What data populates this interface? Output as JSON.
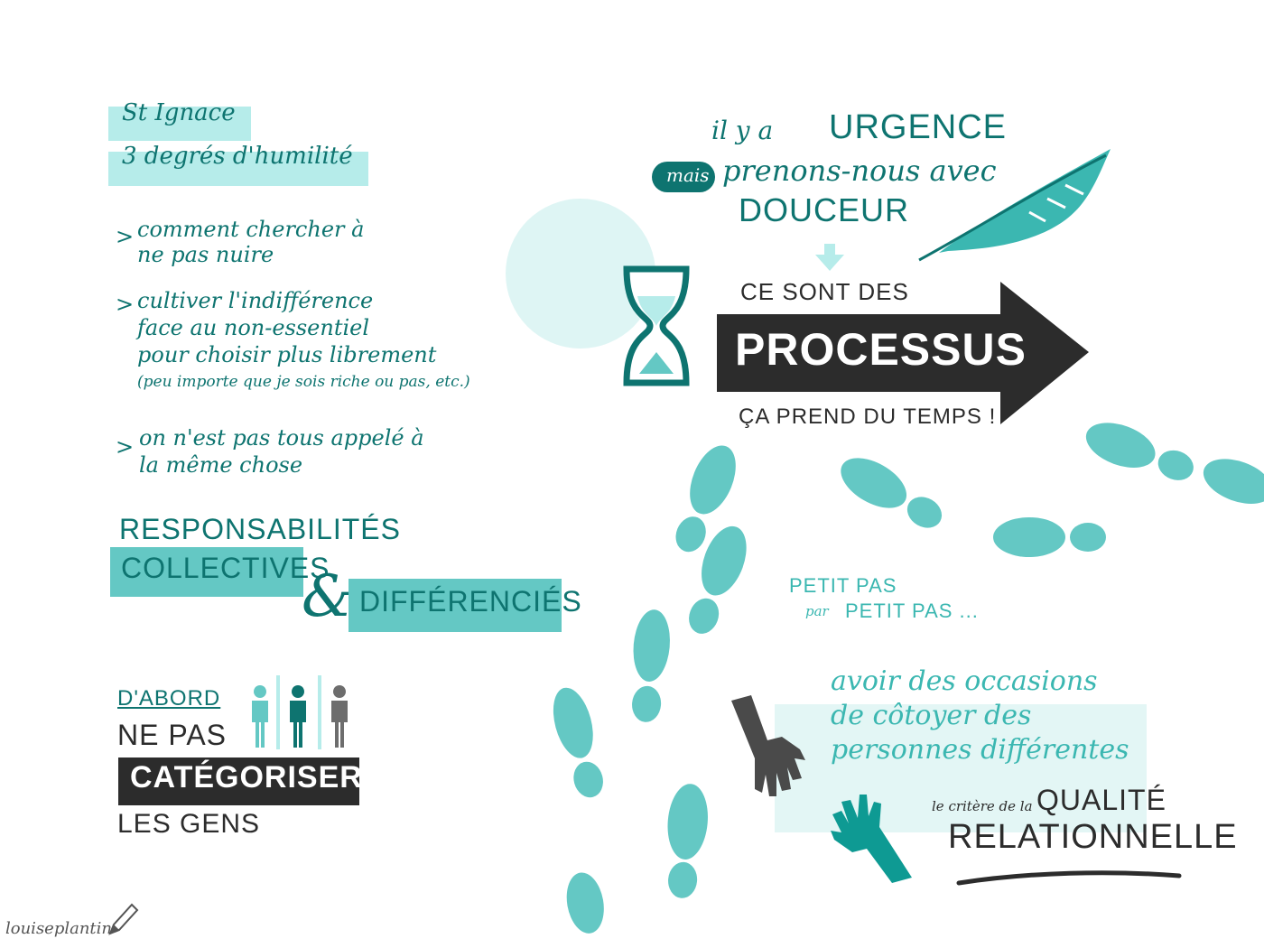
{
  "left": {
    "header_line1": "St Ignace",
    "header_line2": "3 degrés d'humilité",
    "bullets": [
      {
        "marker": ">",
        "lines": [
          "comment chercher à",
          "ne pas nuire"
        ]
      },
      {
        "marker": ">",
        "lines": [
          "cultiver l'indifférence",
          "face au non-essentiel",
          "pour choisir plus librement",
          "(peu importe que je sois riche ou pas, etc.)"
        ]
      },
      {
        "marker": ">",
        "lines": [
          "on n'est pas tous appelé à",
          "la même chose"
        ]
      }
    ],
    "resp_word1": "RESPONSABILITÉS",
    "resp_word2": "COLLECTIVES",
    "resp_amp": "&",
    "resp_word3": "DIFFÉRENCIÉS",
    "dabord": "D'ABORD",
    "ne_pas": "NE PAS",
    "categoriser": "CATÉGORISER",
    "les_gens": "LES GENS"
  },
  "right": {
    "urgence_line1_pre": "il y a",
    "urgence_line1_word": "URGENCE",
    "mais_badge": "mais",
    "urgence_line2": "prenons-nous avec",
    "urgence_line3": "DOUCEUR",
    "ce_sont_des": "CE SONT DES",
    "processus": "PROCESSUS",
    "ca_prend": "ÇA PREND DU TEMPS !",
    "petit_pas_line1": "PETIT PAS",
    "petit_pas_par": "par",
    "petit_pas_line2": "PETIT PAS ...",
    "occasions_lines": [
      "avoir des occasions",
      "de côtoyer des",
      "personnes différentes"
    ],
    "critere_pre": "le critère de la",
    "critere_word1": "QUALITÉ",
    "critere_word2": "RELATIONNELLE"
  },
  "signature": "louiseplantin",
  "colors": {
    "teal_dark": "#0e7470",
    "teal_mid": "#64c8c4",
    "teal_light": "#b6ecea",
    "charcoal": "#2c2c2c",
    "grey": "#6d6d6d"
  },
  "icons": [
    "hourglass-icon",
    "feather-icon",
    "arrow-icon",
    "footprints-icon",
    "people-icon",
    "grey-hand-icon",
    "teal-hand-icon",
    "pencil-icon"
  ]
}
